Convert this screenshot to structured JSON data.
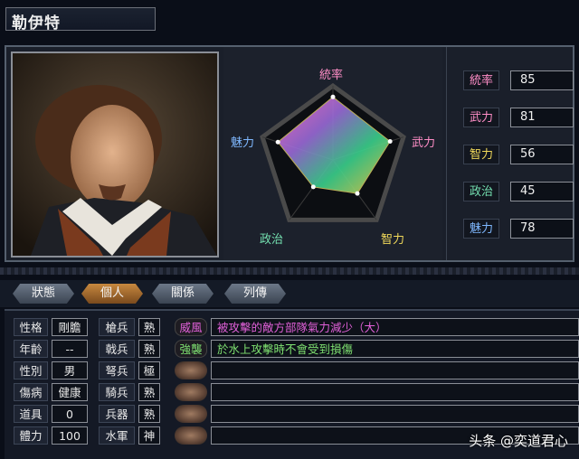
{
  "officer_name": "勒伊特",
  "radar": {
    "labels": {
      "top": "統率",
      "right": "武力",
      "bottom_right": "智力",
      "bottom_left": "政治",
      "left": "魅力"
    },
    "values_pct": [
      85,
      81,
      56,
      45,
      78
    ]
  },
  "stats": [
    {
      "label": "統率",
      "value": "85",
      "color": "#ff8ec7"
    },
    {
      "label": "武力",
      "value": "81",
      "color": "#ff8ec7"
    },
    {
      "label": "智力",
      "value": "56",
      "color": "#f0d85a"
    },
    {
      "label": "政治",
      "value": "45",
      "color": "#74e0b0"
    },
    {
      "label": "魅力",
      "value": "78",
      "color": "#7fb8ff"
    }
  ],
  "tabs": [
    {
      "label": "狀態"
    },
    {
      "label": "個人"
    },
    {
      "label": "關係"
    },
    {
      "label": "列傳"
    }
  ],
  "active_tab": "個人",
  "personal": [
    {
      "label": "性格",
      "value": "剛膽"
    },
    {
      "label": "年齡",
      "value": "--"
    },
    {
      "label": "性別",
      "value": "男"
    },
    {
      "label": "傷病",
      "value": "健康"
    },
    {
      "label": "道具",
      "value": "0"
    },
    {
      "label": "體力",
      "value": "100"
    }
  ],
  "troops": [
    {
      "label": "槍兵",
      "value": "熟"
    },
    {
      "label": "戟兵",
      "value": "熟"
    },
    {
      "label": "弩兵",
      "value": "極"
    },
    {
      "label": "騎兵",
      "value": "熟"
    },
    {
      "label": "兵器",
      "value": "熟"
    },
    {
      "label": "水軍",
      "value": "神"
    }
  ],
  "skills": [
    {
      "name": "威風",
      "desc": "被攻擊的敵方部隊氣力減少（大）",
      "color": "#e060d8"
    },
    {
      "name": "強襲",
      "desc": "於水上攻擊時不會受到損傷",
      "color": "#7ee070"
    },
    {
      "name": "",
      "desc": ""
    },
    {
      "name": "",
      "desc": ""
    },
    {
      "name": "",
      "desc": ""
    },
    {
      "name": "",
      "desc": ""
    }
  ],
  "watermark": "头条 @奕道君心",
  "colors": {
    "accent_tab": "#c7883f",
    "panel": "#1a1f2a"
  }
}
